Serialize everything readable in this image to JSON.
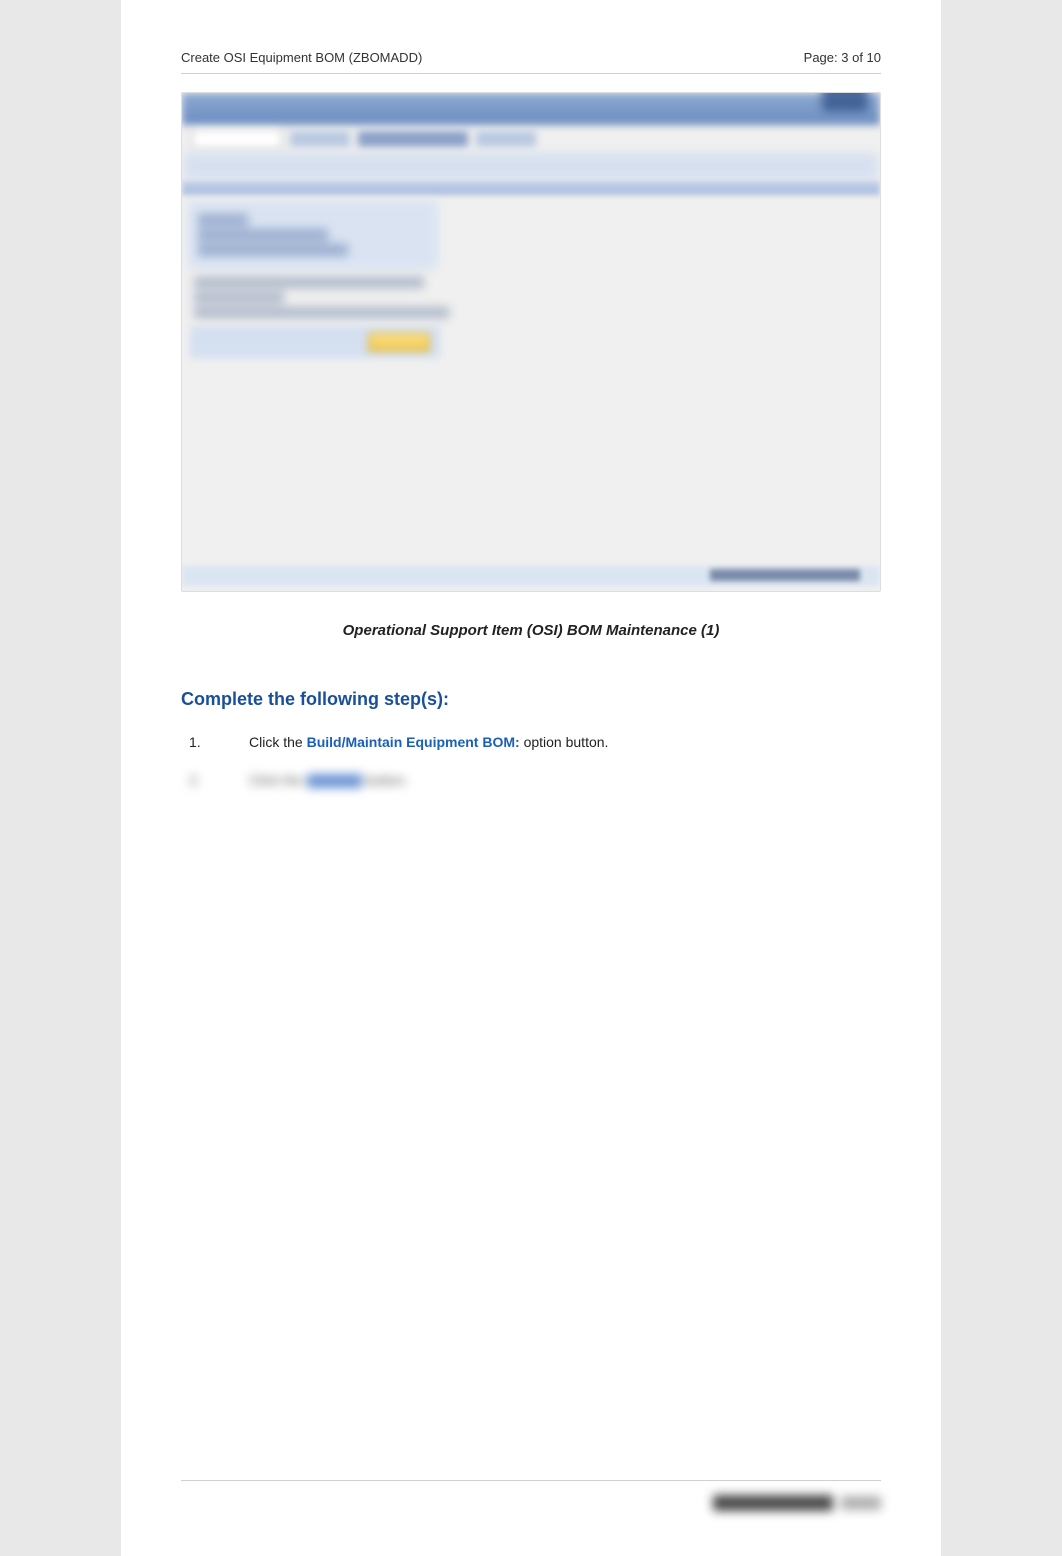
{
  "header": {
    "title": "Create OSI Equipment BOM (ZBOMADD)",
    "page_indicator": "Page: 3 of 10"
  },
  "caption": "Operational Support Item (OSI) BOM Maintenance (1)",
  "steps_heading": "Complete the following step(s):",
  "steps": [
    {
      "num": "1.",
      "pre": "Click the ",
      "link": "Build/Maintain Equipment BOM: ",
      "post": "option button."
    },
    {
      "num": "2.",
      "pre": "Click the ",
      "link": "Execute",
      "post": " button."
    }
  ]
}
